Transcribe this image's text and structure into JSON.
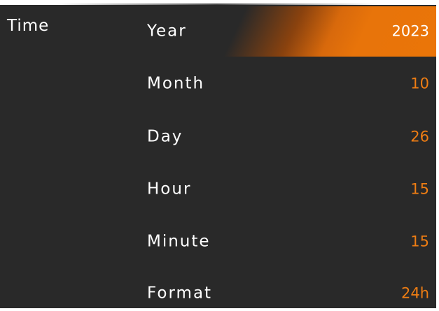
{
  "panel": {
    "title": "Time"
  },
  "settings": [
    {
      "label": "Year",
      "value": "2023",
      "selected": true
    },
    {
      "label": "Month",
      "value": "10",
      "selected": false
    },
    {
      "label": "Day",
      "value": "26",
      "selected": false
    },
    {
      "label": "Hour",
      "value": "15",
      "selected": false
    },
    {
      "label": "Minute",
      "value": "15",
      "selected": false
    },
    {
      "label": "Format",
      "value": "24h",
      "selected": false
    }
  ],
  "colors": {
    "background": "#292929",
    "accent": "#ee7d13",
    "text": "#ffffff"
  }
}
